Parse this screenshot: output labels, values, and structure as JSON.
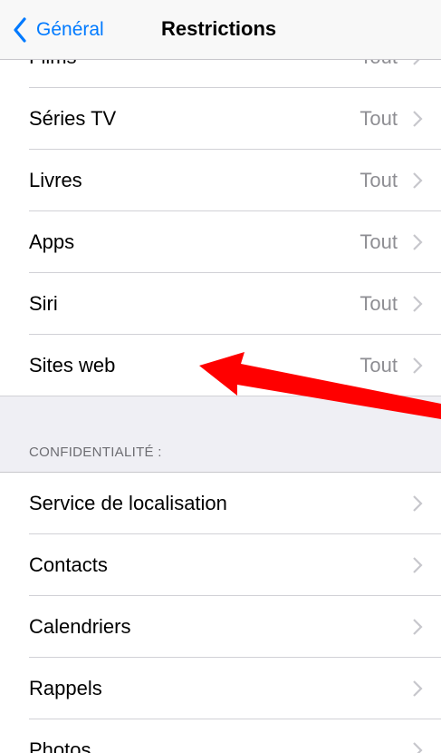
{
  "navbar": {
    "back_label": "Général",
    "title": "Restrictions"
  },
  "rows_top": [
    {
      "label": "Films",
      "value": "Tout"
    },
    {
      "label": "Séries TV",
      "value": "Tout"
    },
    {
      "label": "Livres",
      "value": "Tout"
    },
    {
      "label": "Apps",
      "value": "Tout"
    },
    {
      "label": "Siri",
      "value": "Tout"
    },
    {
      "label": "Sites web",
      "value": "Tout"
    }
  ],
  "privacy": {
    "header": "CONFIDENTIALITÉ :",
    "rows": [
      {
        "label": "Service de localisation"
      },
      {
        "label": "Contacts"
      },
      {
        "label": "Calendriers"
      },
      {
        "label": "Rappels"
      },
      {
        "label": "Photos"
      }
    ]
  },
  "colors": {
    "accent": "#007aff",
    "annotation_arrow": "#ff0000",
    "group_background": "#efeff4"
  },
  "icons": {
    "back": "chevron-left-icon",
    "disclosure": "chevron-right-icon"
  }
}
